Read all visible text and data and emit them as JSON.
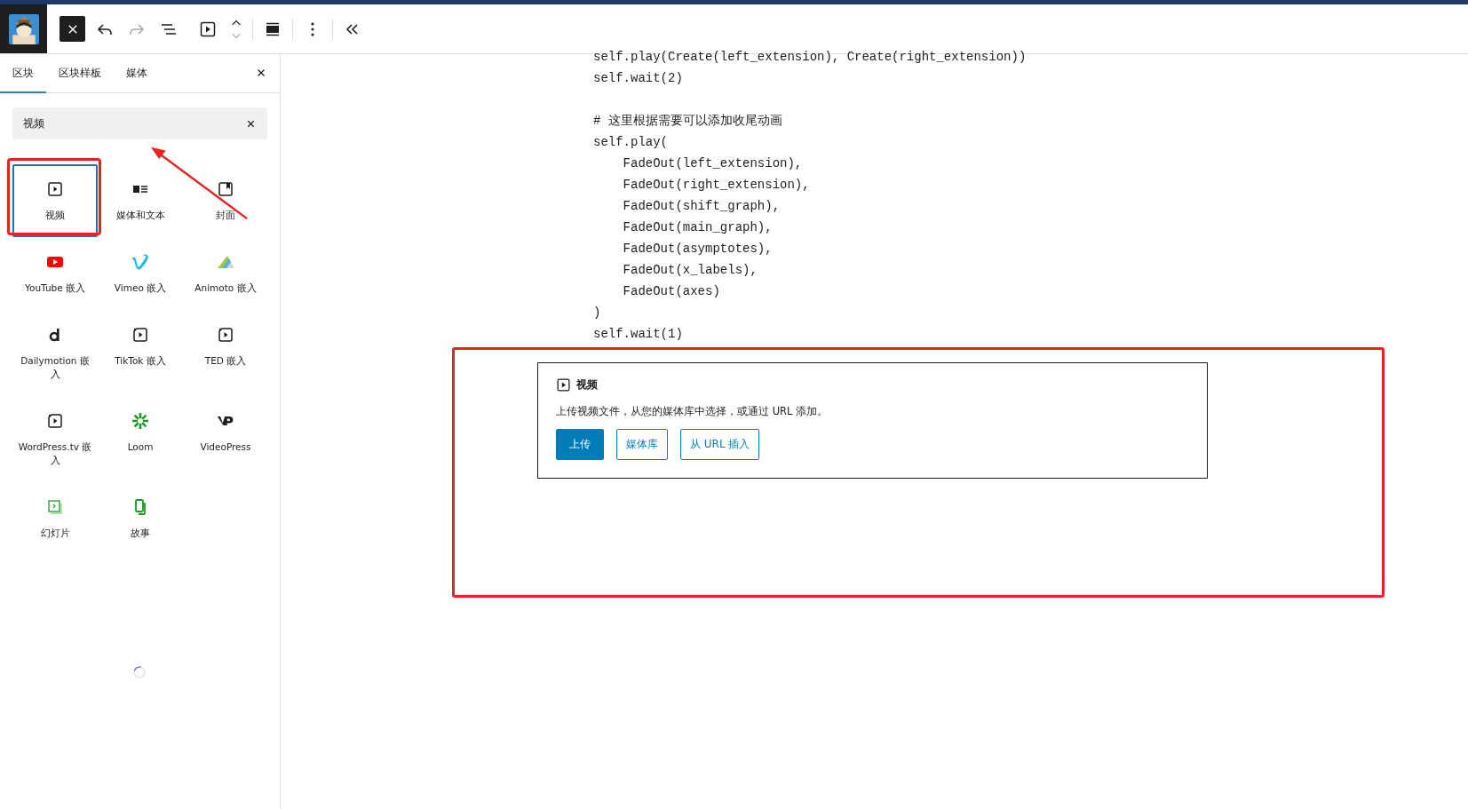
{
  "tabs": [
    {
      "label": "区块",
      "selected": true
    },
    {
      "label": "区块样板",
      "selected": false
    },
    {
      "label": "媒体",
      "selected": false
    }
  ],
  "search": {
    "value": "视频"
  },
  "blocks": [
    {
      "label": "视频",
      "kind": "video",
      "selected": true
    },
    {
      "label": "媒体和文本",
      "kind": "media-text",
      "selected": false
    },
    {
      "label": "封面",
      "kind": "cover",
      "selected": false
    },
    {
      "label": "YouTube 嵌入",
      "kind": "youtube",
      "selected": false
    },
    {
      "label": "Vimeo 嵌入",
      "kind": "vimeo",
      "selected": false
    },
    {
      "label": "Animoto 嵌入",
      "kind": "animoto",
      "selected": false
    },
    {
      "label": "Dailymotion 嵌入",
      "kind": "dailymotion",
      "selected": false
    },
    {
      "label": "TikTok 嵌入",
      "kind": "embed",
      "selected": false
    },
    {
      "label": "TED 嵌入",
      "kind": "embed",
      "selected": false
    },
    {
      "label": "WordPress.tv 嵌入",
      "kind": "embed",
      "selected": false
    },
    {
      "label": "Loom",
      "kind": "loom",
      "selected": false
    },
    {
      "label": "VideoPress",
      "kind": "videopress",
      "selected": false
    },
    {
      "label": "幻灯片",
      "kind": "slides",
      "selected": false
    },
    {
      "label": "故事",
      "kind": "story",
      "selected": false
    }
  ],
  "code_groups": [
    [
      "self.play(Create(left_extension), Create(right_extension))",
      "self.wait(2)"
    ],
    [
      "# 这里根据需要可以添加收尾动画",
      "self.play(",
      "    FadeOut(left_extension),",
      "    FadeOut(right_extension),",
      "    FadeOut(shift_graph),",
      "    FadeOut(main_graph),",
      "    FadeOut(asymptotes),",
      "    FadeOut(x_labels),",
      "    FadeOut(axes)",
      ")",
      "self.wait(1)"
    ]
  ],
  "video_placeholder": {
    "title": "视频",
    "instructions": "上传视频文件，从您的媒体库中选择，或通过 URL 添加。",
    "buttons": [
      {
        "label": "上传",
        "kind": "primary"
      },
      {
        "label": "媒体库",
        "kind": "secondary"
      },
      {
        "label": "从 URL 插入",
        "kind": "secondary"
      }
    ]
  }
}
